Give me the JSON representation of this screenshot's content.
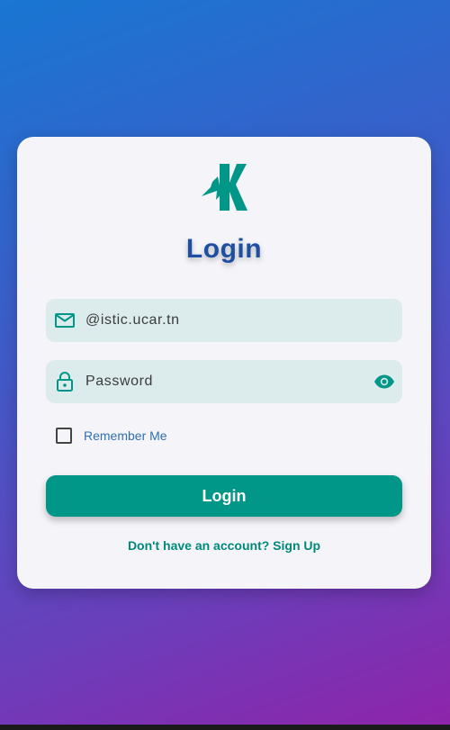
{
  "colors": {
    "accent": "#009688",
    "title": "#1e4fa0",
    "link": "#00897b",
    "remember_label": "#2f6fb3",
    "field_bg": "#dcebec",
    "card_bg": "#f4f4f9",
    "gradient_start": "#1976d2",
    "gradient_end": "#8e24aa"
  },
  "logo": {
    "icon": "lightning-k-logo"
  },
  "login_form": {
    "title": "Login",
    "email": {
      "value": "@istic.ucar.tn",
      "icon": "mail-icon"
    },
    "password": {
      "placeholder": "Password",
      "icon": "lock-icon",
      "toggle_icon": "eye-icon"
    },
    "remember_me": {
      "label": "Remember Me",
      "checked": false
    },
    "submit_label": "Login",
    "signup_link": "Don't have an account? Sign Up"
  }
}
